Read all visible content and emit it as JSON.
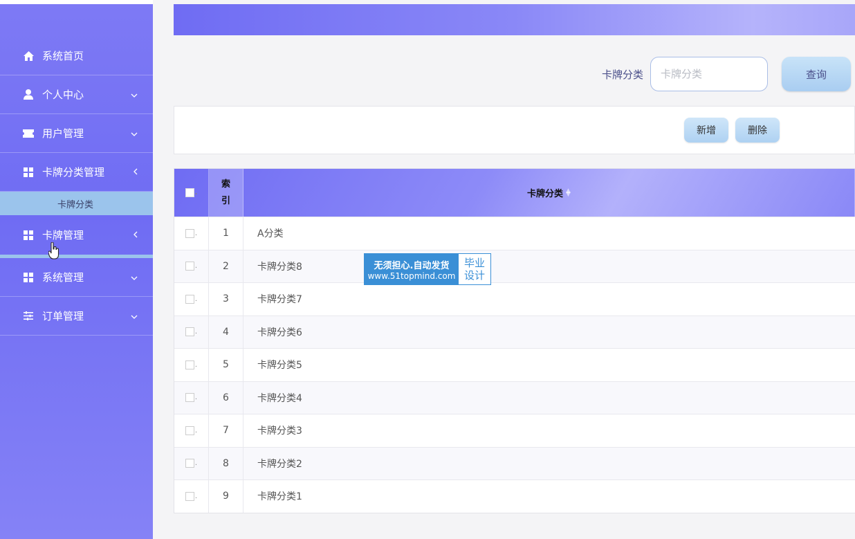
{
  "sidebar": {
    "items": [
      {
        "label": "系统首页",
        "icon": "home-icon",
        "arrow": ""
      },
      {
        "label": "个人中心",
        "icon": "user-icon",
        "arrow": "﹀"
      },
      {
        "label": "用户管理",
        "icon": "ticket-icon",
        "arrow": "﹀"
      },
      {
        "label": "卡牌分类管理",
        "icon": "grid-icon",
        "arrow": "‹"
      },
      {
        "label": "卡牌管理",
        "icon": "grid-icon",
        "arrow": "‹"
      },
      {
        "label": "系统管理",
        "icon": "grid-icon",
        "arrow": "﹀"
      },
      {
        "label": "订单管理",
        "icon": "sliders-icon",
        "arrow": "﹀"
      }
    ],
    "submenu": {
      "label": "卡牌分类"
    }
  },
  "search": {
    "label": "卡牌分类",
    "placeholder": "卡牌分类",
    "button": "查询"
  },
  "actions": {
    "add": "新增",
    "delete": "删除"
  },
  "table": {
    "headers": {
      "index": "索引",
      "name": "卡牌分类"
    },
    "rows": [
      {
        "index": "1",
        "name": "A分类"
      },
      {
        "index": "2",
        "name": "卡牌分类8"
      },
      {
        "index": "3",
        "name": "卡牌分类7"
      },
      {
        "index": "4",
        "name": "卡牌分类6"
      },
      {
        "index": "5",
        "name": "卡牌分类5"
      },
      {
        "index": "6",
        "name": "卡牌分类4"
      },
      {
        "index": "7",
        "name": "卡牌分类3"
      },
      {
        "index": "8",
        "name": "卡牌分类2"
      },
      {
        "index": "9",
        "name": "卡牌分类1"
      }
    ]
  },
  "watermark": {
    "line1": "无须担心.自动发货",
    "line2": "www.51topmind.com",
    "right1": "毕业",
    "right2": "设计"
  },
  "colors": {
    "accent": "#6f6cf3",
    "submenu": "#9bc4ec",
    "button": "#aed1f2"
  }
}
